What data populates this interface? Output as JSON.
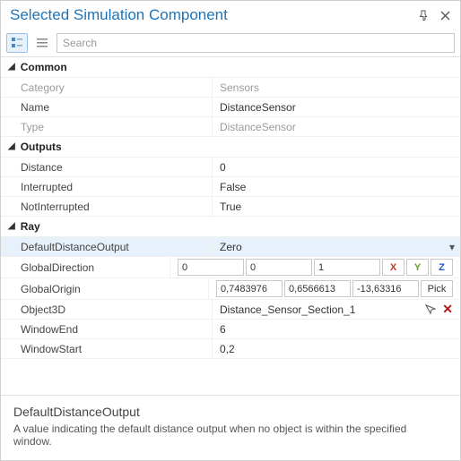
{
  "title": "Selected Simulation Component",
  "search": {
    "placeholder": "Search",
    "value": ""
  },
  "sections": {
    "common": {
      "title": "Common",
      "category": {
        "label": "Category",
        "value": "Sensors"
      },
      "name": {
        "label": "Name",
        "value": "DistanceSensor"
      },
      "type": {
        "label": "Type",
        "value": "DistanceSensor"
      }
    },
    "outputs": {
      "title": "Outputs",
      "distance": {
        "label": "Distance",
        "value": "0"
      },
      "interrupted": {
        "label": "Interrupted",
        "value": "False"
      },
      "notinterrupted": {
        "label": "NotInterrupted",
        "value": "True"
      }
    },
    "ray": {
      "title": "Ray",
      "defaultDistanceOutput": {
        "label": "DefaultDistanceOutput",
        "value": "Zero"
      },
      "globalDirection": {
        "label": "GlobalDirection",
        "v0": "0",
        "v1": "0",
        "v2": "1",
        "axisX": "X",
        "axisY": "Y",
        "axisZ": "Z"
      },
      "globalOrigin": {
        "label": "GlobalOrigin",
        "v0": "0,7483976",
        "v1": "0,6566613",
        "v2": "-13,63316",
        "pick": "Pick"
      },
      "object3d": {
        "label": "Object3D",
        "value": "Distance_Sensor_Section_1"
      },
      "windowEnd": {
        "label": "WindowEnd",
        "value": "6"
      },
      "windowStart": {
        "label": "WindowStart",
        "value": "0,2"
      }
    }
  },
  "description": {
    "title": "DefaultDistanceOutput",
    "body": "A value indicating the default distance output when no object is within the specified window."
  }
}
